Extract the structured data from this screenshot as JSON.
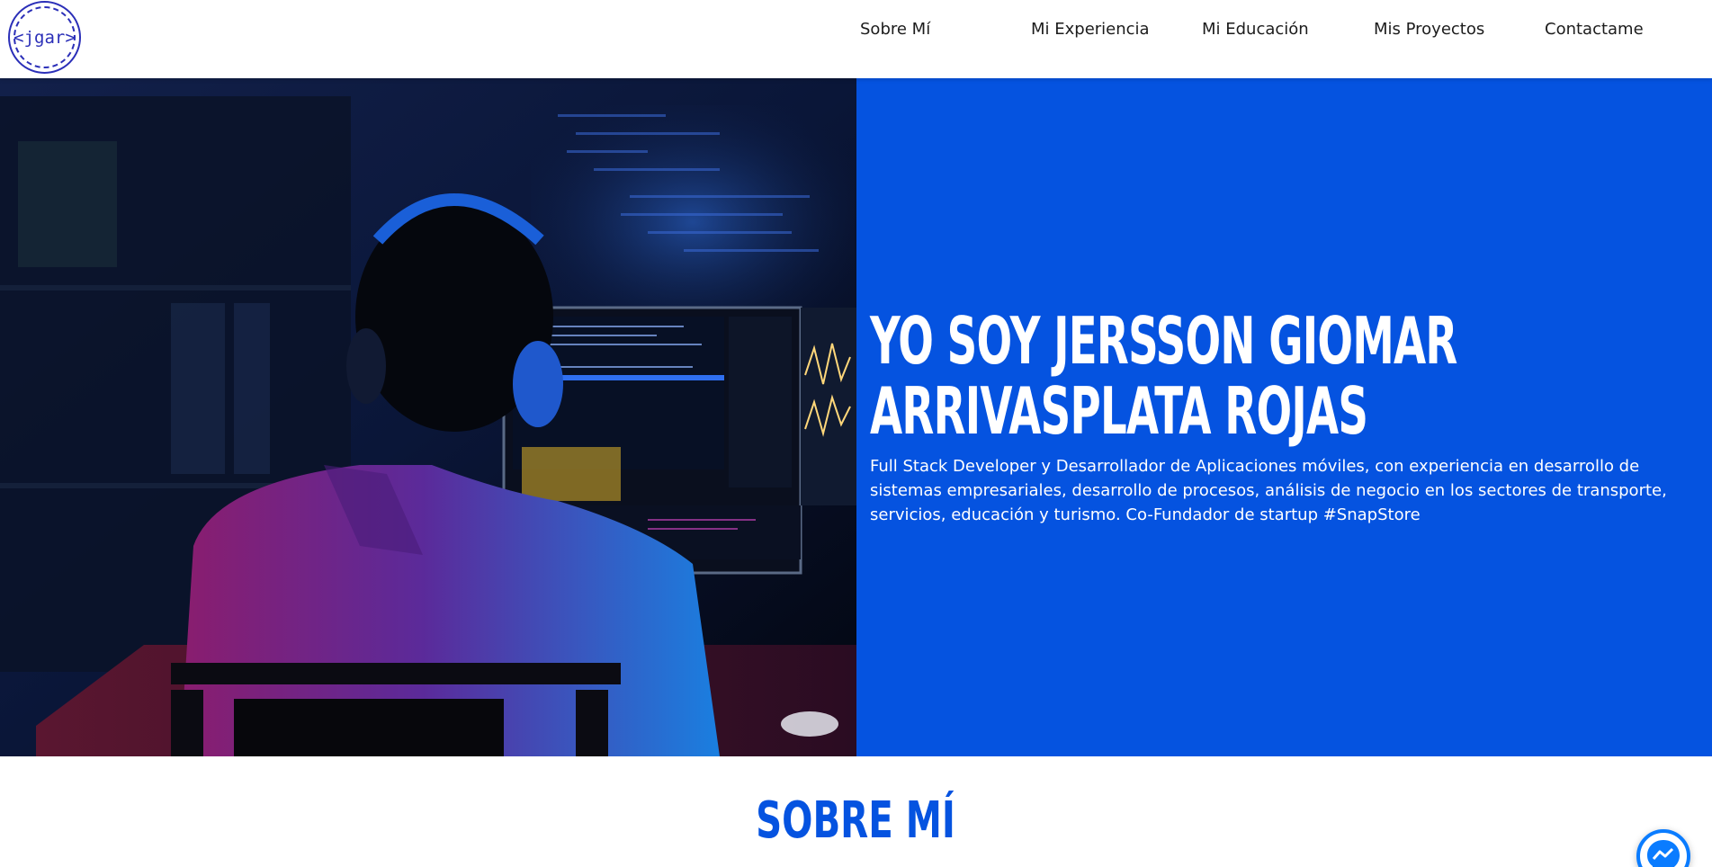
{
  "logo": {
    "text": "<jgar>"
  },
  "nav": {
    "items": [
      {
        "label": "Sobre Mí"
      },
      {
        "label": "Mi Experiencia"
      },
      {
        "label": "Mi Educación"
      },
      {
        "label": "Mis Proyectos"
      },
      {
        "label": "Contactame"
      }
    ]
  },
  "hero": {
    "title_line1": "YO SOY JERSSON GIOMAR",
    "title_line2": "ARRIVASPLATA ROJAS",
    "description": "Full Stack Developer y Desarrollador de Aplicaciones móviles, con experiencia en desarrollo de sistemas empresariales, desarrollo de procesos, análisis de negocio en los sectores de transporte, servicios, educación y turismo. Co-Fundador de startup #SnapStore",
    "image_icon": "developer-at-computer-photo"
  },
  "about": {
    "title": "SOBRE MÍ"
  },
  "chat": {
    "icon": "messenger-icon"
  },
  "colors": {
    "accent": "#0553e0",
    "logo": "#2b2fb8",
    "messenger": "#0a7cff"
  }
}
